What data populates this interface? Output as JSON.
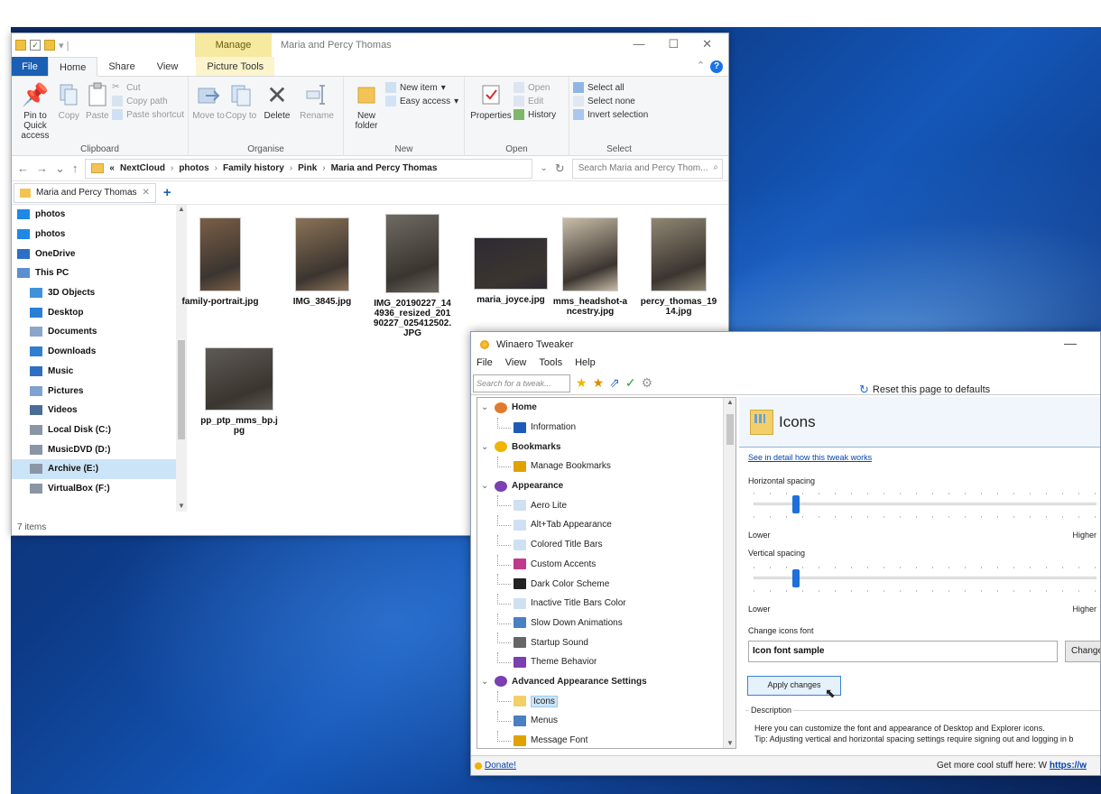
{
  "explorer": {
    "context_tab": "Manage",
    "window_title": "Maria and Percy Thomas",
    "tabs": [
      "File",
      "Home",
      "Share",
      "View",
      "Picture Tools"
    ],
    "ribbon": {
      "clipboard": {
        "pin": "Pin to Quick access",
        "copy": "Copy",
        "paste": "Paste",
        "cut": "Cut",
        "copy_path": "Copy path",
        "paste_shortcut": "Paste shortcut",
        "label": "Clipboard"
      },
      "organise": {
        "move_to": "Move to",
        "copy_to": "Copy to",
        "delete": "Delete",
        "rename": "Rename",
        "label": "Organise"
      },
      "new": {
        "new_folder": "New folder",
        "new_item": "New item",
        "easy_access": "Easy access",
        "label": "New"
      },
      "open": {
        "properties": "Properties",
        "open": "Open",
        "edit": "Edit",
        "history": "History",
        "label": "Open"
      },
      "select": {
        "select_all": "Select all",
        "select_none": "Select none",
        "invert": "Invert selection",
        "label": "Select"
      }
    },
    "address": {
      "overflow": "«",
      "crumbs": [
        "NextCloud",
        "photos",
        "Family history",
        "Pink",
        "Maria and Percy Thomas"
      ],
      "search_placeholder": "Search Maria and Percy Thom..."
    },
    "folder_tab": "Maria and Percy Thomas",
    "nav_items": [
      {
        "label": "photos",
        "icon": "nextcloud-icon"
      },
      {
        "label": "photos",
        "icon": "nextcloud-icon"
      },
      {
        "label": "OneDrive",
        "icon": "onedrive-icon"
      },
      {
        "label": "This PC",
        "icon": "pc-icon"
      },
      {
        "label": "3D Objects",
        "icon": "3d-objects-icon"
      },
      {
        "label": "Desktop",
        "icon": "desktop-icon"
      },
      {
        "label": "Documents",
        "icon": "documents-icon"
      },
      {
        "label": "Downloads",
        "icon": "downloads-icon"
      },
      {
        "label": "Music",
        "icon": "music-icon"
      },
      {
        "label": "Pictures",
        "icon": "pictures-icon"
      },
      {
        "label": "Videos",
        "icon": "videos-icon"
      },
      {
        "label": "Local Disk (C:)",
        "icon": "drive-icon"
      },
      {
        "label": "MusicDVD (D:)",
        "icon": "drive-icon"
      },
      {
        "label": "Archive (E:)",
        "icon": "drive-icon"
      },
      {
        "label": "VirtualBox (F:)",
        "icon": "drive-icon"
      }
    ],
    "files": [
      {
        "name": "family-portrait.jpg"
      },
      {
        "name": "IMG_3845.jpg"
      },
      {
        "name": "IMG_20190227_144936_resized_20190227_025412502.JPG"
      },
      {
        "name": "maria_joyce.jpg"
      },
      {
        "name": "mms_headshot-ancestry.jpg"
      },
      {
        "name": "percy_thomas_1914.jpg"
      },
      {
        "name": "pp_ptp_mms_bp.jpg"
      }
    ],
    "status": "7 items"
  },
  "winaero": {
    "title": "Winaero Tweaker",
    "menu": [
      "File",
      "View",
      "Tools",
      "Help"
    ],
    "search_placeholder": "Search for a tweak...",
    "reset": "Reset this page to defaults",
    "tree": [
      {
        "type": "cat",
        "label": "Home"
      },
      {
        "type": "leaf",
        "label": "Information"
      },
      {
        "type": "cat",
        "label": "Bookmarks"
      },
      {
        "type": "leaf",
        "label": "Manage Bookmarks"
      },
      {
        "type": "cat",
        "label": "Appearance"
      },
      {
        "type": "leaf",
        "label": "Aero Lite"
      },
      {
        "type": "leaf",
        "label": "Alt+Tab Appearance"
      },
      {
        "type": "leaf",
        "label": "Colored Title Bars"
      },
      {
        "type": "leaf",
        "label": "Custom Accents"
      },
      {
        "type": "leaf",
        "label": "Dark Color Scheme"
      },
      {
        "type": "leaf",
        "label": "Inactive Title Bars Color"
      },
      {
        "type": "leaf",
        "label": "Slow Down Animations"
      },
      {
        "type": "leaf",
        "label": "Startup Sound"
      },
      {
        "type": "leaf",
        "label": "Theme Behavior"
      },
      {
        "type": "cat",
        "label": "Advanced Appearance Settings"
      },
      {
        "type": "leaf",
        "label": "Icons",
        "selected": true
      },
      {
        "type": "leaf",
        "label": "Menus"
      },
      {
        "type": "leaf",
        "label": "Message Font"
      }
    ],
    "panel": {
      "heading": "Icons",
      "detail_link": "See in detail how this tweak works",
      "horizontal_label": "Horizontal spacing",
      "horizontal_level": 0.12,
      "vertical_label": "Vertical spacing",
      "vertical_level": 0.12,
      "lower": "Lower",
      "higher": "Higher",
      "font_label": "Change icons font",
      "font_sample": "Icon font sample",
      "change_button": "Change",
      "apply_button": "Apply changes",
      "description_label": "Description",
      "description_1": "Here you can customize the font and appearance of Desktop and Explorer icons.",
      "description_2": "Tip: Adjusting vertical and horizontal spacing settings require signing out and logging in b"
    },
    "status": {
      "donate": "Donate!",
      "more": "Get more cool stuff here: W",
      "link": "https://w"
    }
  }
}
